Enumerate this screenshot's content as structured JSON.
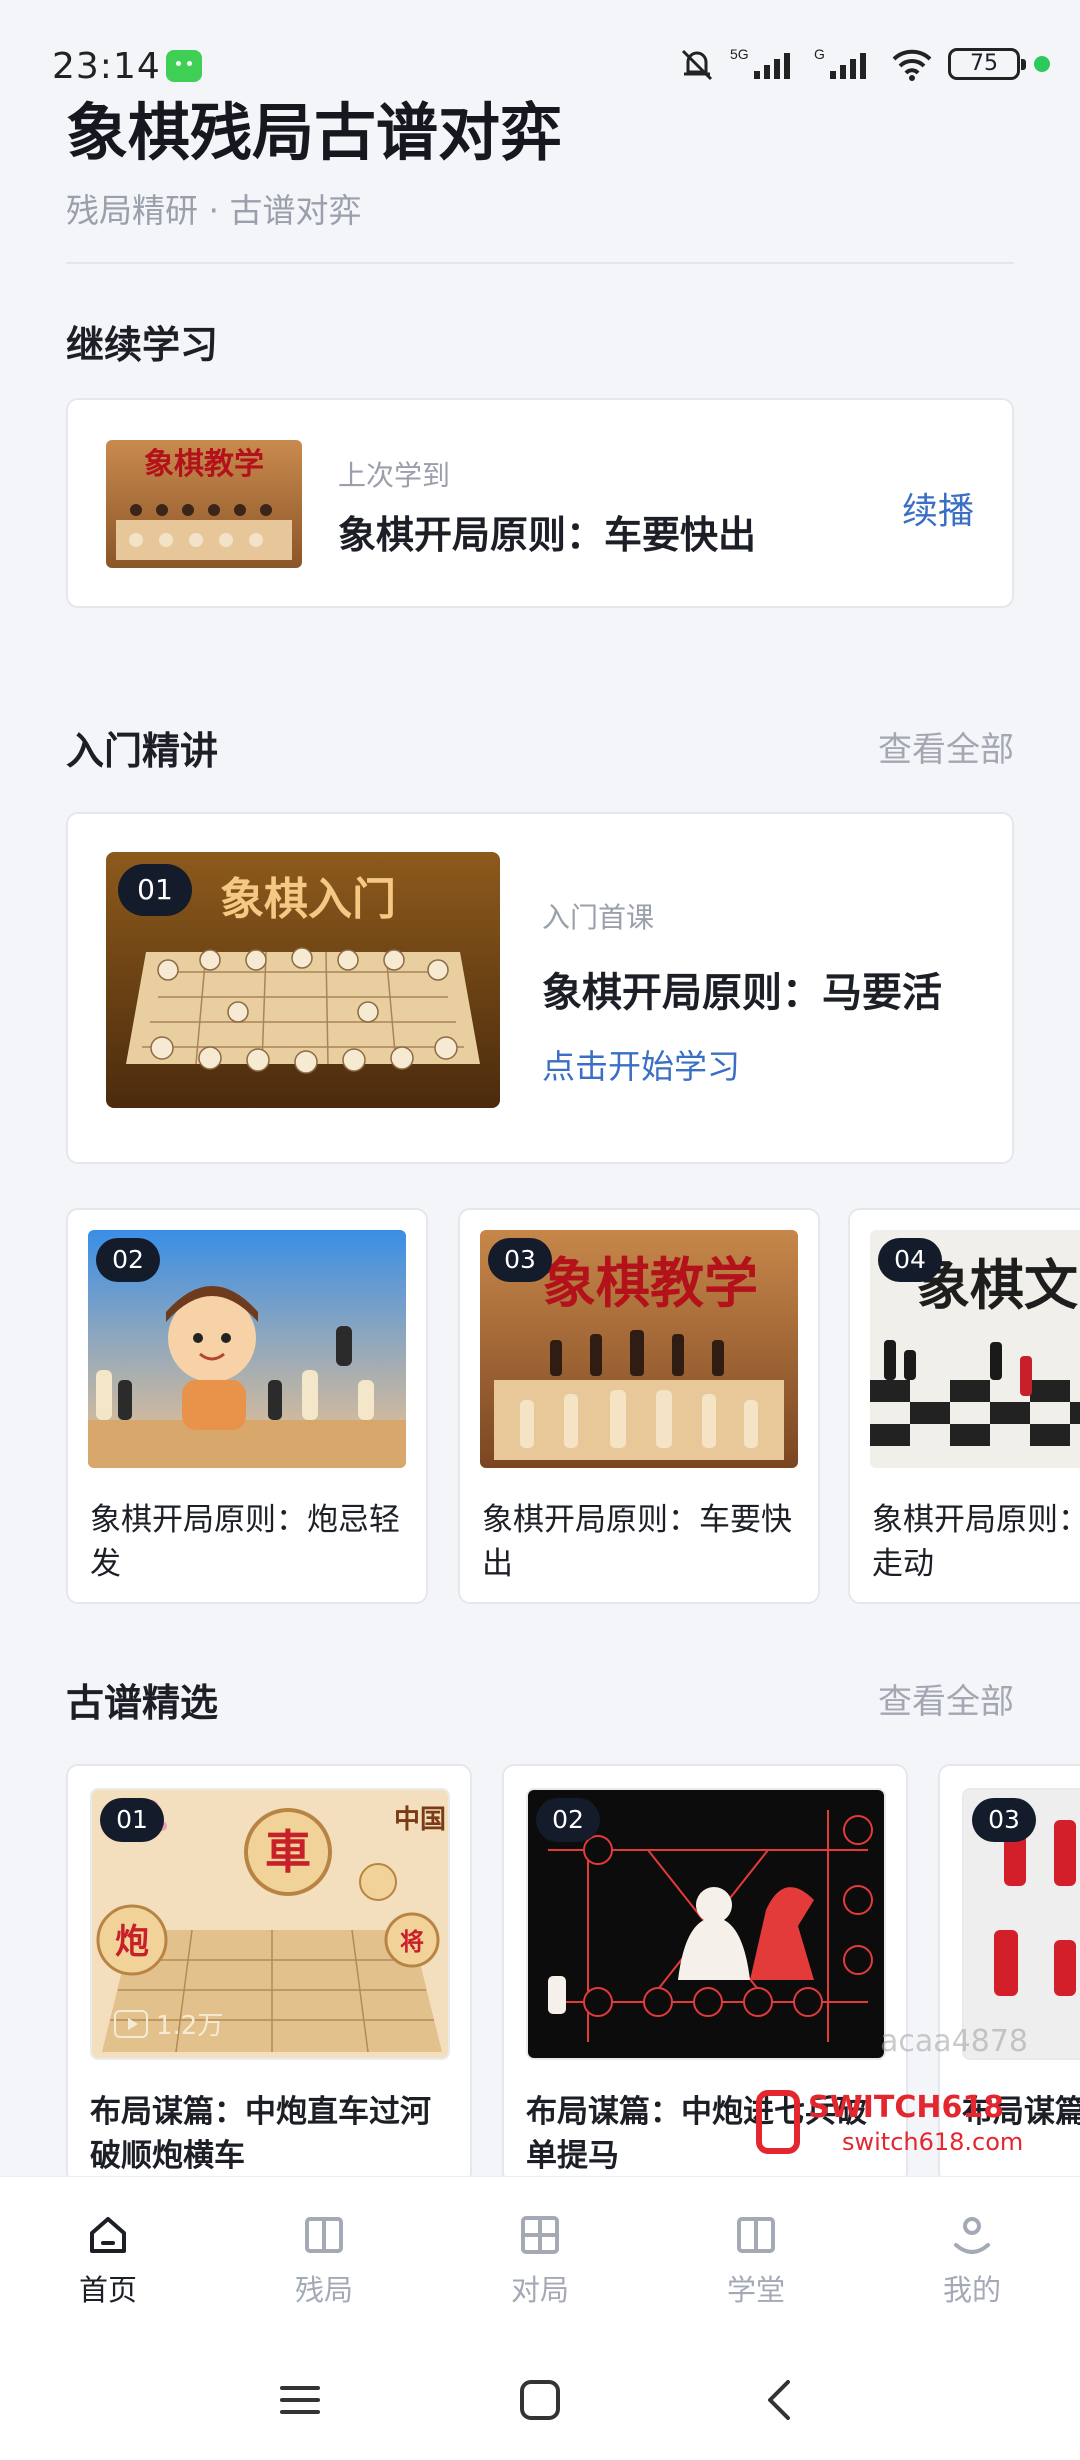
{
  "status_bar": {
    "time": "23:14",
    "battery": "75",
    "network": "5G"
  },
  "header": {
    "title": "象棋残局古谱对弈",
    "subtitle": "残局精研 · 古谱对弈"
  },
  "continue": {
    "section_title": "继续学习",
    "small_label": "上次学到",
    "lesson_title": "象棋开局原则：车要快出",
    "resume_label": "续播",
    "thumb_text": "象棋教学"
  },
  "intro": {
    "section_title": "入门精讲",
    "see_all": "查看全部",
    "featured": {
      "badge": "01",
      "thumb_text": "象棋入门",
      "small_label": "入门首课",
      "title": "象棋开局原则：马要活",
      "link": "点击开始学习"
    },
    "courses": [
      {
        "badge": "02",
        "title": "象棋开局原则：炮忌轻发"
      },
      {
        "badge": "03",
        "title": "象棋开局原则：车要快出",
        "thumb_text": "象棋教学"
      },
      {
        "badge": "04",
        "title": "象棋开局原则：不要多走动",
        "thumb_text": "象棋文"
      }
    ]
  },
  "classics": {
    "section_title": "古谱精选",
    "see_all": "查看全部",
    "items": [
      {
        "badge": "01",
        "title": "布局谋篇：中炮直车过河破顺炮横车",
        "views": "1.2万",
        "thumb_text": "中国"
      },
      {
        "badge": "02",
        "title": "布局谋篇：中炮进七兵破单提马"
      },
      {
        "badge": "03",
        "title": "布局谋篇：补士”破"
      }
    ]
  },
  "watermark": {
    "text": "acaa4878",
    "brand": "SWITCH618",
    "url": "switch618.com"
  },
  "bottom_nav": [
    {
      "label": "首页",
      "active": true
    },
    {
      "label": "残局",
      "active": false
    },
    {
      "label": "对局",
      "active": false
    },
    {
      "label": "学堂",
      "active": false
    },
    {
      "label": "我的",
      "active": false
    }
  ],
  "colors": {
    "accent": "#3a6fc4",
    "badge": "#141b2b",
    "background": "#f3f5f8"
  }
}
